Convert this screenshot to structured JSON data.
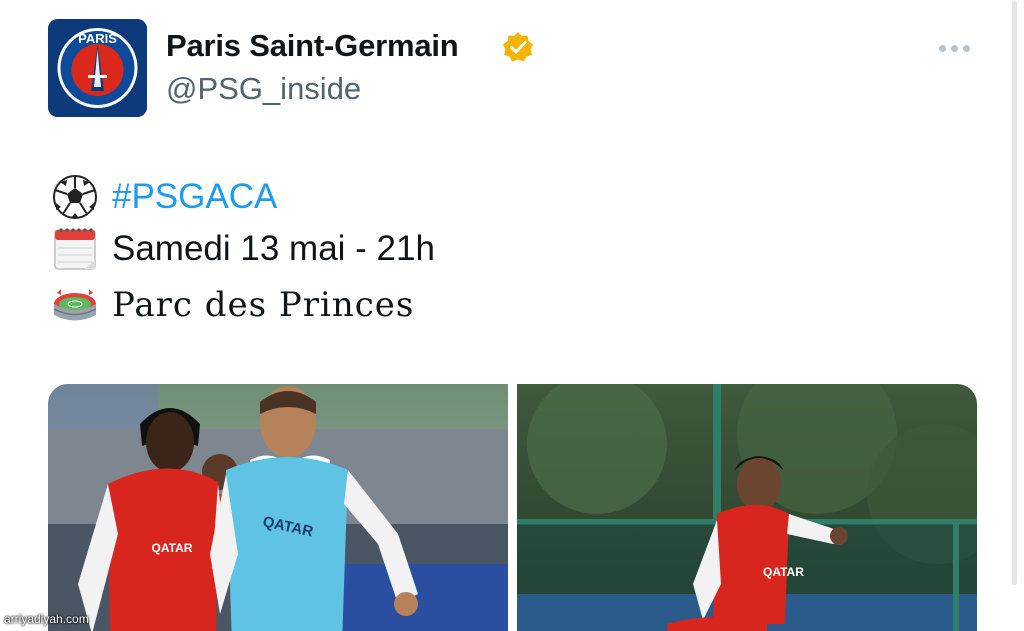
{
  "tweet": {
    "author": {
      "display_name": "Paris Saint-Germain",
      "handle": "@PSG_inside",
      "avatar_text": "PARIS",
      "avatar_icon": "psg-crest-icon",
      "verified_icon": "verified-badge-icon",
      "verified_color": "#f4b400"
    },
    "more_icon": "more-options-icon",
    "lines": [
      {
        "icon": "soccer-ball-icon",
        "text": "#PSGACA",
        "kind": "hashtag"
      },
      {
        "icon": "calendar-icon",
        "text": "Samedi 13 mai - 21h",
        "kind": "text"
      },
      {
        "icon": "stadium-icon",
        "text": "Parc des Princes",
        "kind": "text"
      }
    ],
    "media": [
      {
        "name": "training-photo-left",
        "jersey_sponsor": "QATAR"
      },
      {
        "name": "training-photo-right",
        "jersey_sponsor": "QATAR"
      }
    ]
  },
  "colors": {
    "hashtag": "#1d9bf0",
    "handle": "#536471",
    "avatar_bg": "#0d3a7a",
    "psg_red": "#da291c"
  },
  "watermark": "arriyadiyah.com"
}
